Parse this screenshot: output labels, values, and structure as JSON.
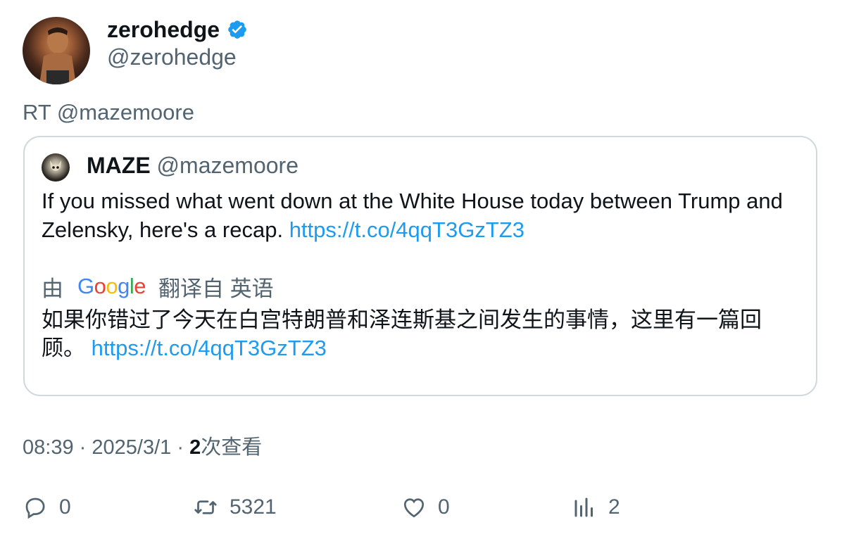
{
  "author": {
    "name": "zerohedge",
    "handle": "@zerohedge",
    "verified": true
  },
  "retweet_line": "RT @mazemoore",
  "quote": {
    "name": "MAZE",
    "handle": "@mazemoore",
    "text": "If you missed what went down at the White House today between Trump and Zelensky, here's a recap.",
    "link": "https://t.co/4qqT3GzTZ3",
    "translation_by": "由",
    "translation_provider": "Google",
    "translated_from": "翻译自 英语",
    "translated_text": "如果你错过了今天在白宫特朗普和泽连斯基之间发生的事情，这里有一篇回顾。",
    "translated_link": "https://t.co/4qqT3GzTZ3"
  },
  "meta": {
    "time": "08:39",
    "separator": "·",
    "date": "2025/3/1",
    "views_count": "2",
    "views_label": "次查看"
  },
  "actions": {
    "replies": "0",
    "retweets": "5321",
    "likes": "0",
    "views": "2"
  },
  "colors": {
    "accent": "#1d9bf0",
    "secondary_text": "#536471",
    "border": "#cfd9de"
  }
}
